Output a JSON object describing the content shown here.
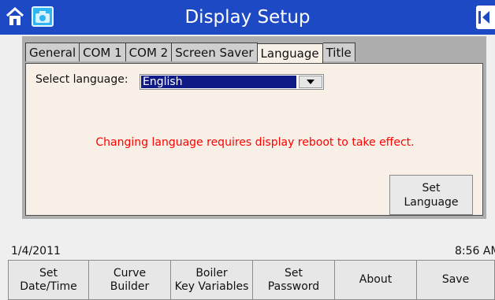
{
  "header": {
    "title": "Display Setup",
    "home_icon": "home-icon",
    "camera_icon": "camera-icon",
    "back_icon": "back-arrow-icon"
  },
  "tabs": [
    {
      "label": "General",
      "active": false
    },
    {
      "label": "COM 1",
      "active": false
    },
    {
      "label": "COM 2",
      "active": false
    },
    {
      "label": "Screen Saver",
      "active": false
    },
    {
      "label": "Language",
      "active": true
    },
    {
      "label": "Title",
      "active": false
    }
  ],
  "language_panel": {
    "select_label": "Select language:",
    "selected_language": "English",
    "warning": "Changing language requires display reboot to take effect.",
    "set_button": [
      "Set",
      "Language"
    ]
  },
  "status": {
    "date": "1/4/2011",
    "time": "8:56 AM"
  },
  "bottom_buttons": [
    [
      "Set",
      "Date/Time"
    ],
    [
      "Curve",
      "Builder"
    ],
    [
      "Boiler",
      "Key Variables"
    ],
    [
      "Set",
      "Password"
    ],
    [
      "About"
    ],
    [
      "Save"
    ]
  ],
  "colors": {
    "header": "#1d49c4",
    "panel_bg": "#f8f0e6",
    "warning": "#ff0000",
    "select_highlight": "#101a86"
  }
}
